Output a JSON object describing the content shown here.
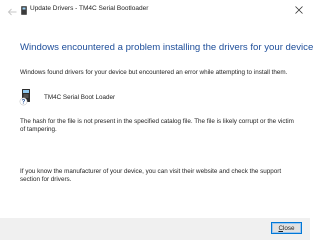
{
  "titlebar": {
    "title": "Update Drivers - TM4C Serial Bootloader"
  },
  "icons": {
    "back": "back-arrow-icon",
    "title": "device-icon",
    "close": "close-icon",
    "device": "device-warning-icon"
  },
  "content": {
    "heading": "Windows encountered a problem installing the drivers for your device",
    "description": "Windows found drivers for your device but encountered an error while attempting to install them.",
    "device_name": "TM4C Serial Boot Loader",
    "hash_message": "The hash for the file is not present in the specified catalog file. The file is likely corrupt or the victim of tampering.",
    "support_message": "If you know the manufacturer of your device, you can visit their website and check the support section for drivers."
  },
  "footer": {
    "close_accel": "C",
    "close_rest": "lose"
  },
  "colors": {
    "heading": "#1e4e9a",
    "footer_bg": "#f0f0f0",
    "button_border": "#0078d7"
  }
}
